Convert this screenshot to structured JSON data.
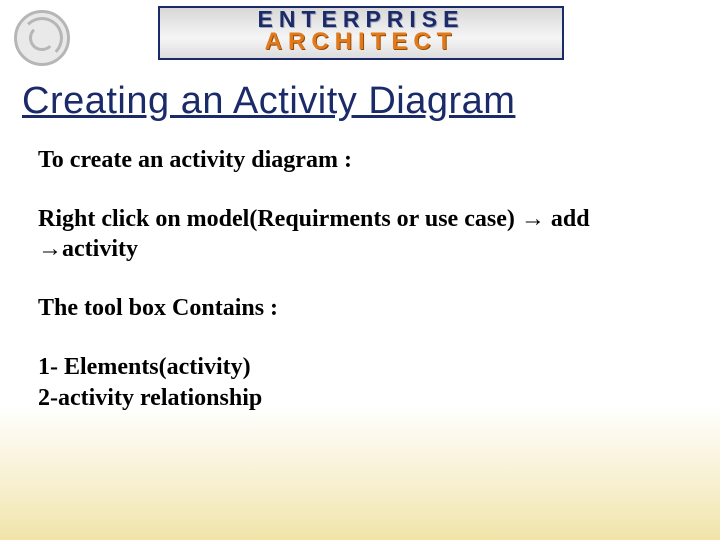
{
  "brand": {
    "line1": "ENTERPRISE",
    "line2": "ARCHITECT"
  },
  "title": "Creating an Activity Diagram",
  "content": {
    "intro": "To create an activity diagram :",
    "steps": "Right click on model(Requirments or use case) → add →activity",
    "toolbox_heading": "The tool box Contains  :",
    "toolbox_items": "1- Elements(activity)\n2-activity relationship"
  }
}
